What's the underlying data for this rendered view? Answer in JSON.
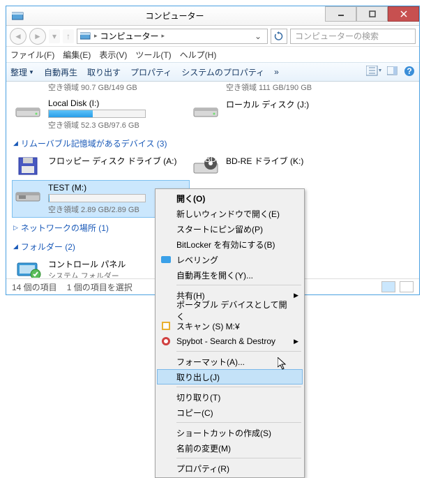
{
  "titlebar": {
    "title": "コンピューター"
  },
  "addrbar": {
    "location": "コンピューター",
    "search_placeholder": "コンピューターの検索"
  },
  "menubar": {
    "file": "ファイル(F)",
    "edit": "編集(E)",
    "view": "表示(V)",
    "tools": "ツール(T)",
    "help": "ヘルプ(H)"
  },
  "toolbar": {
    "organize": "整理",
    "autoplay": "自動再生",
    "eject": "取り出す",
    "properties": "プロパティ",
    "sysprops": "システムのプロパティ",
    "more": "»"
  },
  "drives": {
    "top_free_left": "空き領域 90.7 GB/149 GB",
    "top_free_right": "空き領域 111 GB/190 GB",
    "local_i_name": "Local Disk (I:)",
    "local_i_free": "空き領域 52.3 GB/97.6 GB",
    "local_j_name": "ローカル ディスク (J:)",
    "removable_header": "リムーバブル記憶域があるデバイス (3)",
    "floppy_name": "フロッピー ディスク ドライブ (A:)",
    "bdre_name": "BD-RE ドライブ (K:)",
    "test_name": "TEST (M:)",
    "test_free": "空き領域 2.89 GB/2.89 GB",
    "network_header": "ネットワークの場所 (1)",
    "folder_header": "フォルダー (2)",
    "cpanel_name": "コントロール パネル",
    "cpanel_sub": "システム フォルダー"
  },
  "statusbar": {
    "count": "14 個の項目",
    "selected": "1 個の項目を選択"
  },
  "ctx": {
    "open": "開く(O)",
    "newwin": "新しいウィンドウで開く(E)",
    "pinstart": "スタートにピン留め(P)",
    "bitlocker": "BitLocker を有効にする(B)",
    "leveling": "レベリング",
    "autoplay": "自動再生を開く(Y)...",
    "share": "共有(H)",
    "portable": "ポータブル デバイスとして開く",
    "scan": "スキャン (S) M:¥",
    "spybot": "Spybot - Search & Destroy",
    "format": "フォーマット(A)...",
    "eject": "取り出し(J)",
    "cut": "切り取り(T)",
    "copy": "コピー(C)",
    "shortcut": "ショートカットの作成(S)",
    "rename": "名前の変更(M)",
    "props": "プロパティ(R)"
  }
}
